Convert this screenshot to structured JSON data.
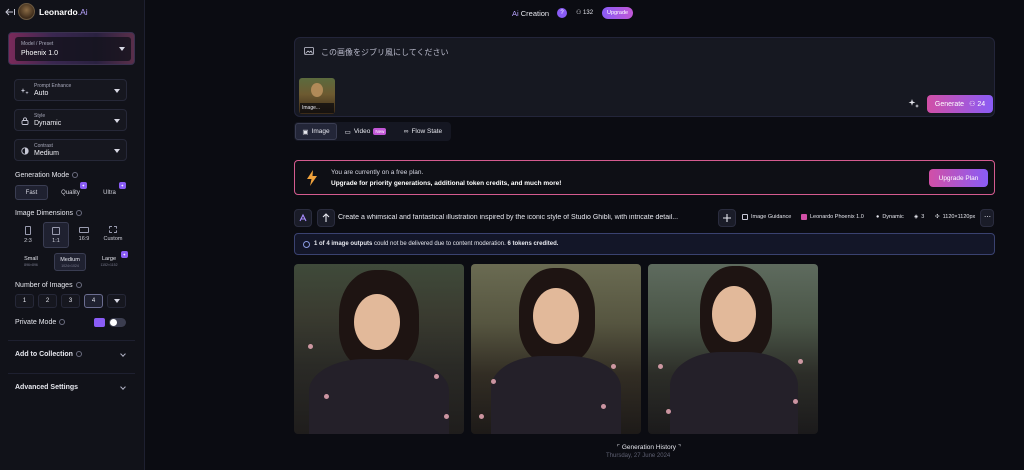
{
  "brand": {
    "name": "Leonardo",
    "suffix": ".Ai"
  },
  "header": {
    "title_prefix": "Ai",
    "title_rest": " Creation",
    "help": "?",
    "tokens": "132",
    "upgrade": "Upgrade"
  },
  "sidebar": {
    "model": {
      "label": "Model / Preset",
      "value": "Phoenix 1.0"
    },
    "prompt_enhance": {
      "label": "Prompt Enhance",
      "value": "Auto"
    },
    "style": {
      "label": "Style",
      "value": "Dynamic"
    },
    "contrast": {
      "label": "Contrast",
      "value": "Medium"
    },
    "generation_mode": {
      "title": "Generation Mode",
      "options": [
        "Fast",
        "Quality",
        "Ultra"
      ],
      "selected": "Fast"
    },
    "image_dimensions": {
      "title": "Image Dimensions",
      "ratios": [
        "2:3",
        "1:1",
        "16:9",
        "Custom"
      ],
      "selected_ratio": "1:1",
      "sizes": [
        {
          "label": "Small",
          "res": "896×896"
        },
        {
          "label": "Medium",
          "res": "1024×1024"
        },
        {
          "label": "Large",
          "res": "1152×1152"
        }
      ],
      "selected_size": "Medium"
    },
    "number_of_images": {
      "title": "Number of Images",
      "options": [
        "1",
        "2",
        "3",
        "4"
      ],
      "selected": "4"
    },
    "private_mode": {
      "title": "Private Mode",
      "enabled": false
    },
    "add_to_collection": "Add to Collection",
    "advanced_settings": "Advanced Settings"
  },
  "prompt": {
    "text": "この画像をジブリ風にしてください",
    "thumbnail_label": "Image...",
    "generate_label": "Generate",
    "generate_cost": "24"
  },
  "mode_tabs": [
    {
      "label": "Image",
      "active": true
    },
    {
      "label": "Video",
      "badge": "New"
    },
    {
      "label": "Flow State"
    }
  ],
  "upgrade_banner": {
    "line1": "You are currently on a free plan.",
    "line2": "Upgrade for priority generations, additional token credits, and much more!",
    "button": "Upgrade Plan"
  },
  "generation": {
    "prompt": "Create a whimsical and fantastical illustration inspired by the iconic style of Studio Ghibli, with intricate detail...",
    "chips": [
      "Image Guidance",
      "Leonardo Phoenix 1.0",
      "Dynamic",
      "3",
      "1120×1120px"
    ],
    "notice_lead": "1 of 4 image outputs",
    "notice_mid": " could not be delivered due to content moderation. ",
    "notice_tail": "6 tokens credited."
  },
  "history": {
    "label": "Generation History",
    "date": "Thursday, 27 June 2024"
  },
  "colors": {
    "accent_pink": "#d14fa6",
    "accent_purple": "#8a5cf6",
    "background": "#0b0c12"
  }
}
